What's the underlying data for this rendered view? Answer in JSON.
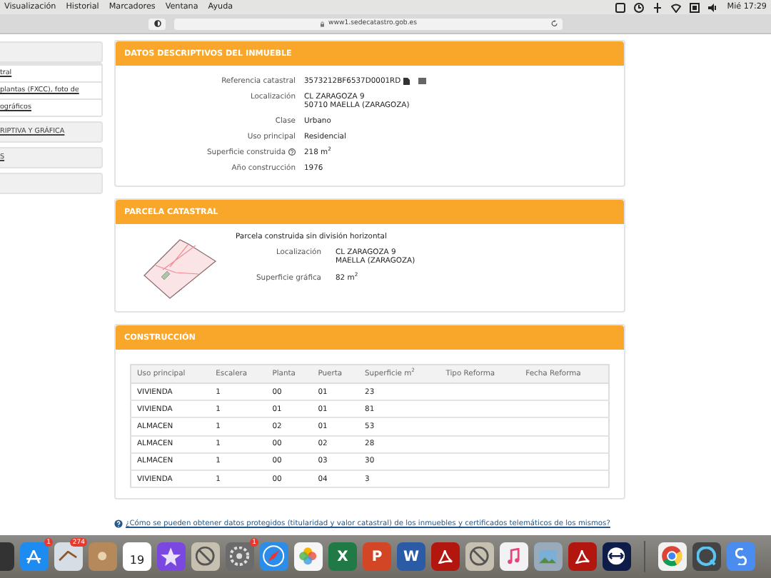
{
  "menubar": {
    "items": [
      "Visualización",
      "Historial",
      "Marcadores",
      "Ventana",
      "Ayuda"
    ],
    "clock": "Mié 17:29"
  },
  "browser": {
    "url": "www1.sedecatastro.gob.es"
  },
  "sidebar": {
    "links": [
      "tral",
      "plantas (FXCC), foto de",
      "ográficos"
    ],
    "sections": [
      {
        "kind": "link",
        "label": "RIPTIVA Y GRÁFICA"
      },
      {
        "kind": "link",
        "label": "S"
      },
      {
        "kind": "blank"
      }
    ]
  },
  "datos": {
    "title": "DATOS DESCRIPTIVOS DEL INMUEBLE",
    "fields": [
      {
        "label": "Referencia catastral",
        "lines": [
          "3573212BF6537D0001RD"
        ],
        "kind": "reference"
      },
      {
        "label": "Localización",
        "lines": [
          "CL ZARAGOZA 9",
          "50710 MAELLA (ZARAGOZA)"
        ],
        "kind": "plain"
      },
      {
        "label": "Clase",
        "lines": [
          "Urbano"
        ],
        "kind": "plain"
      },
      {
        "label": "Uso principal",
        "lines": [
          "Residencial"
        ],
        "kind": "plain"
      },
      {
        "label": "Superficie construida",
        "lines": [
          "218 m$^{2}$"
        ],
        "kind": "help"
      },
      {
        "label": "Año construcción",
        "lines": [
          "1976"
        ],
        "kind": "plain"
      }
    ]
  },
  "parcela": {
    "title": "PARCELA CATASTRAL",
    "subtitle": "Parcela construida sin división horizontal",
    "fields": [
      {
        "label": "Localización",
        "lines": [
          "CL ZARAGOZA 9",
          "MAELLA (ZARAGOZA)"
        ]
      },
      {
        "label": "Superficie gráfica",
        "lines": [
          "82 m$^{2}$"
        ]
      }
    ]
  },
  "construccion": {
    "title": "CONSTRUCCIÓN",
    "table": {
      "columns": [
        "Uso principal",
        "Escalera",
        "Planta",
        "Puerta",
        "Superficie m$^{2}$",
        "Tipo Reforma",
        "Fecha Reforma"
      ],
      "rows": [
        [
          "VIVIENDA",
          "1",
          "00",
          "01",
          "23"
        ],
        [
          "VIVIENDA",
          "1",
          "01",
          "01",
          "81"
        ],
        [
          "ALMACEN",
          "1",
          "02",
          "01",
          "53"
        ],
        [
          "ALMACEN",
          "1",
          "00",
          "02",
          "28"
        ],
        [
          "ALMACEN",
          "1",
          "00",
          "03",
          "30"
        ],
        [
          "VIVIENDA",
          "1",
          "00",
          "04",
          "3"
        ]
      ]
    }
  },
  "help_link": "¿Cómo se pueden obtener datos protegidos (titularidad y valor catastral) de los inmuebles y certificados telemáticos de los mismos?",
  "dock": {
    "apps": [
      {
        "kind": "screen"
      },
      {
        "kind": "appstore",
        "badge": "1"
      },
      {
        "kind": "mail",
        "badge": "274"
      },
      {
        "kind": "contacts"
      },
      {
        "kind": "calendar",
        "glyph": "19"
      },
      {
        "kind": "star"
      },
      {
        "kind": "blocked"
      },
      {
        "kind": "gear",
        "badge": "1"
      },
      {
        "kind": "compass"
      },
      {
        "kind": "flower"
      },
      {
        "kind": "excel",
        "glyph": "X"
      },
      {
        "kind": "powerpoint",
        "glyph": "P"
      },
      {
        "kind": "word",
        "glyph": "W"
      },
      {
        "kind": "pdf"
      },
      {
        "kind": "blocked"
      },
      {
        "kind": "music"
      },
      {
        "kind": "photo"
      },
      {
        "kind": "pdf"
      },
      {
        "kind": "arrows"
      },
      {
        "kind": "divider"
      },
      {
        "kind": "chrome"
      },
      {
        "kind": "quicktime"
      },
      {
        "kind": "blue"
      }
    ]
  }
}
